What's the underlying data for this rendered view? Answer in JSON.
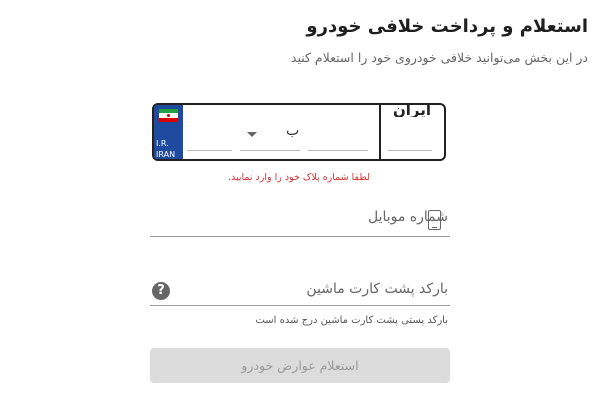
{
  "header": {
    "title": "استعلام و پرداخت خلافی خودرو",
    "subtitle": "در این بخش می‌توانید خلافی خودروی خود را استعلام کنید"
  },
  "plate": {
    "ir_label": "I.R.",
    "iran_en_label": "IRAN",
    "iran_fa_label": "ایران",
    "letter": "ب",
    "error": "لطفا شماره پلاک خود را وارد نمایید.",
    "flag_colors": [
      "#239f40",
      "#ffffff",
      "#da0000"
    ]
  },
  "mobile": {
    "placeholder": "شماره موبایل",
    "icon": "phone-icon"
  },
  "barcode": {
    "placeholder": "بارکد پشت کارت ماشین",
    "icon": "help-icon",
    "icon_glyph": "?",
    "helper": "بارکد پستی پشت کارت ماشین درج شده است"
  },
  "submit": {
    "label": "استعلام عوارض خودرو",
    "enabled": false
  },
  "colors": {
    "error": "#d32f2f",
    "plate_blue": "#1e4aa0",
    "button_disabled_bg": "#dcdcdc"
  }
}
